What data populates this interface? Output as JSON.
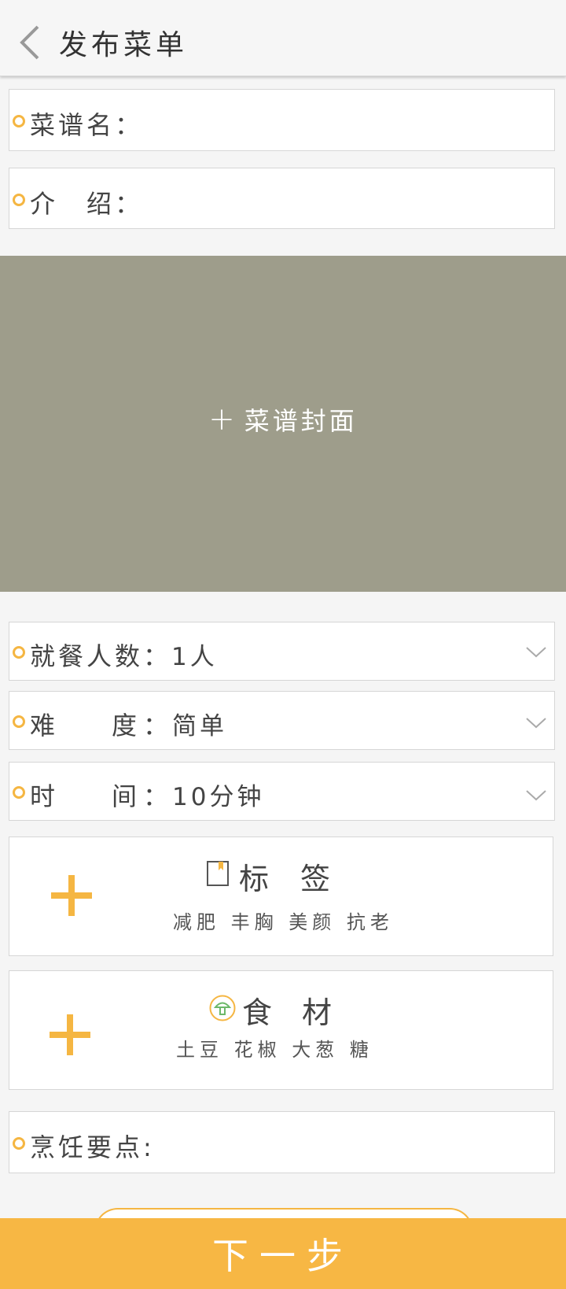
{
  "header": {
    "title": "发布菜单"
  },
  "fields": {
    "recipe_name_label": "菜谱名：",
    "intro_label": "介　绍：",
    "cook_points_label": "烹饪要点:"
  },
  "cover": {
    "label": "菜谱封面"
  },
  "selects": {
    "diners": {
      "label": "就餐人数：",
      "value": "1人"
    },
    "difficulty": {
      "label1": "难",
      "label2": "度",
      "colon": "：",
      "value": "简单"
    },
    "time": {
      "label1": "时",
      "label2": "间",
      "colon": "：",
      "value": "10分钟"
    }
  },
  "tags": {
    "title1": "标",
    "title2": "签",
    "items": "减肥 丰胸 美颜 抗老"
  },
  "ingredients": {
    "title1": "食",
    "title2": "材",
    "items": "土豆 花椒 大葱 糖"
  },
  "footer": {
    "next_label": "下一步"
  },
  "colors": {
    "accent": "#f7b744",
    "cover_bg": "#9e9d8b"
  }
}
